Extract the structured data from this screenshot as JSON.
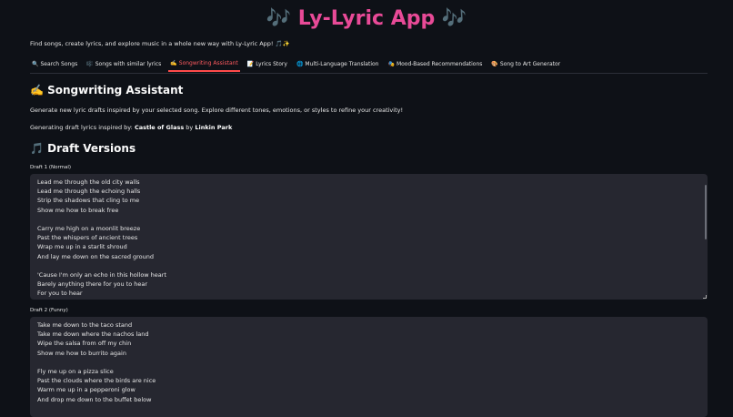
{
  "app": {
    "title": "🎶 Ly-Lyric App 🎶",
    "tagline": "Find songs, create lyrics, and explore music in a whole new way with Ly-Lyric App! 🎵✨"
  },
  "tabs": [
    {
      "icon": "🔍",
      "label": "Search Songs"
    },
    {
      "icon": "🎼",
      "label": "Songs with similar lyrics"
    },
    {
      "icon": "✍️",
      "label": "Songwriting Assistant"
    },
    {
      "icon": "📝",
      "label": "Lyrics Story"
    },
    {
      "icon": "🌐",
      "label": "Multi-Language Translation"
    },
    {
      "icon": "🎭",
      "label": "Mood-Based Recommendations"
    },
    {
      "icon": "🎨",
      "label": "Song to Art Generator"
    }
  ],
  "section": {
    "heading": "✍️ Songwriting Assistant",
    "description": "Generate new lyric drafts inspired by your selected song. Explore different tones, emotions, or styles to refine your creativity!",
    "inspired_prefix": "Generating draft lyrics inspired by: ",
    "song": "Castle of Glass",
    "by": " by ",
    "artist": "Linkin Park",
    "drafts_heading": "🎵 Draft Versions"
  },
  "drafts": [
    {
      "label": "Draft 1 (Normal)",
      "lines": [
        "Lead me through the old city walls",
        "Lead me through the echoing halls",
        "Strip the shadows that cling to me",
        "Show me how to break free",
        "",
        "Carry me high on a moonlit breeze",
        "Past the whispers of ancient trees",
        "Wrap me up in a starlit shroud",
        "And lay me down on the sacred ground",
        "",
        "'Cause I'm only an echo in this hollow heart",
        "Barely anything there for you to hear",
        "For you to hear"
      ]
    },
    {
      "label": "Draft 2 (Funny)",
      "lines": [
        "Take me down to the taco stand",
        "Take me down where the nachos land",
        "Wipe the salsa from off my chin",
        "Show me how to burrito again",
        "",
        "Fly me up on a pizza slice",
        "Past the clouds where the birds are nice",
        "Warm me up in a pepperoni glow",
        "And drop me down to the buffet below"
      ]
    }
  ]
}
